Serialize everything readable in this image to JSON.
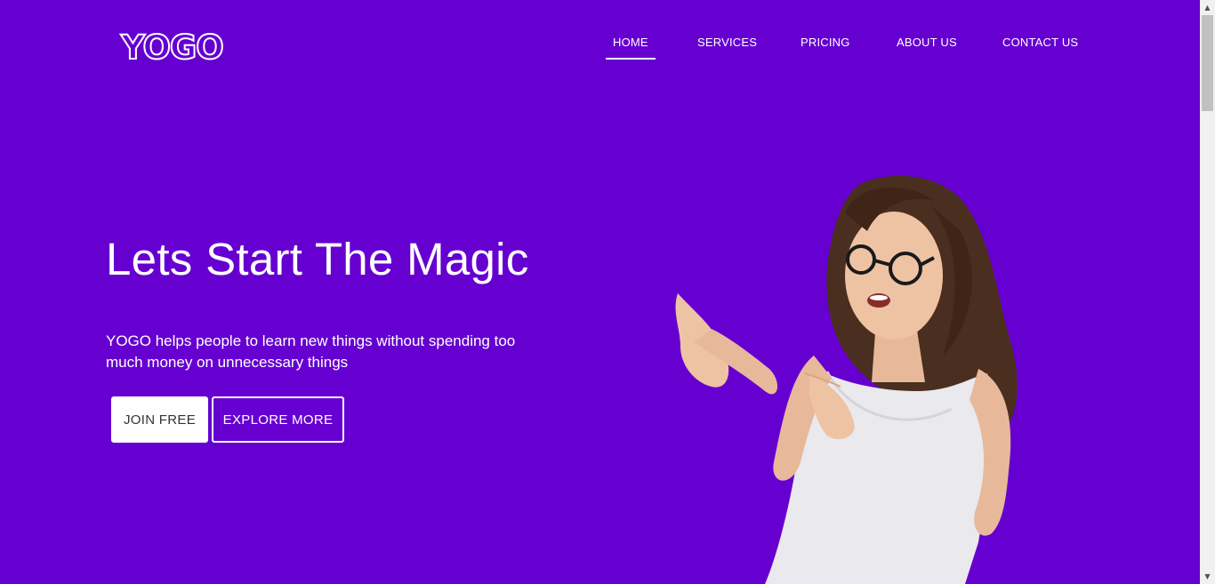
{
  "brand": {
    "logo": "YOGO",
    "color": "#6600d1"
  },
  "nav": {
    "items": [
      {
        "label": "HOME",
        "active": true
      },
      {
        "label": "SERVICES"
      },
      {
        "label": "PRICING"
      },
      {
        "label": "ABOUT US"
      },
      {
        "label": "CONTACT US"
      }
    ]
  },
  "hero": {
    "title": "Lets Start The Magic",
    "text": "YOGO helps people to learn new things without spending too much money on unnecessary things",
    "join_label": "JOIN FREE",
    "explore_label": "EXPLORE MORE"
  },
  "icons": {
    "scroll_up": "▲",
    "scroll_down": "▼"
  }
}
